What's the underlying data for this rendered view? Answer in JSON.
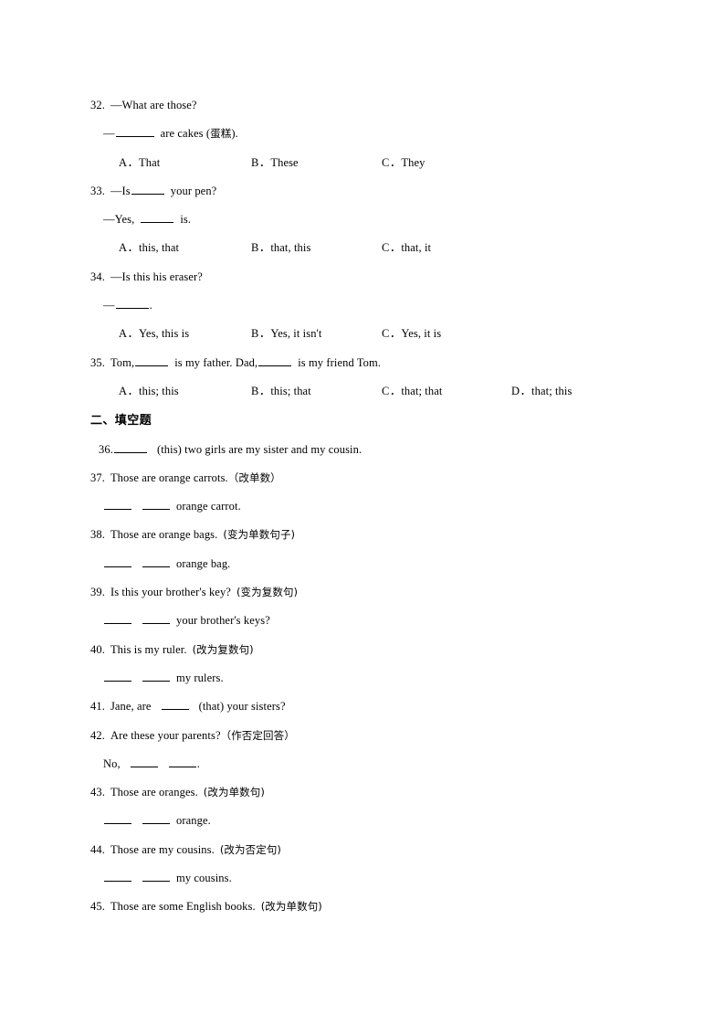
{
  "document": {
    "type": "worksheet",
    "language": "en-zh",
    "page_background": "#ffffff",
    "text_color": "#000000"
  },
  "multiple_choice": {
    "questions": [
      {
        "number": "32.",
        "stem_dash": "—",
        "stem": "What are those?",
        "answer_prefix": "—",
        "answer_suffix": "are cakes (",
        "answer_cjk": "蛋糕",
        "answer_end": ").",
        "options": [
          {
            "letter": "A",
            "sep": "．",
            "text": "That"
          },
          {
            "letter": "B",
            "sep": "．",
            "text": "These"
          },
          {
            "letter": "C",
            "sep": "．",
            "text": "They"
          }
        ]
      },
      {
        "number": "33.",
        "stem_dash": "—",
        "stem_before": "Is",
        "stem_after": "your pen?",
        "answer_prefix": "—Yes,",
        "answer_suffix": "is.",
        "options": [
          {
            "letter": "A",
            "sep": "．",
            "text": "this, that"
          },
          {
            "letter": "B",
            "sep": "．",
            "text": "that, this"
          },
          {
            "letter": "C",
            "sep": "．",
            "text": "that, it"
          }
        ]
      },
      {
        "number": "34.",
        "stem_dash": "—",
        "stem": "Is this his eraser?",
        "answer_prefix": "—",
        "answer_end": ".",
        "options": [
          {
            "letter": "A",
            "sep": "．",
            "text": "Yes, this is"
          },
          {
            "letter": "B",
            "sep": "．",
            "text": "Yes, it isn't"
          },
          {
            "letter": "C",
            "sep": "．",
            "text": "Yes, it is"
          }
        ]
      },
      {
        "number": "35.",
        "stem_part1": "Tom,",
        "stem_part2": "is my father. Dad,",
        "stem_part3": "is my friend Tom.",
        "options": [
          {
            "letter": "A",
            "sep": "．",
            "text": "this; this"
          },
          {
            "letter": "B",
            "sep": "．",
            "text": "this; that"
          },
          {
            "letter": "C",
            "sep": "．",
            "text": "that; that"
          },
          {
            "letter": "D",
            "sep": "．",
            "text": "that; this"
          }
        ]
      }
    ]
  },
  "section_two": {
    "heading_number": "二、",
    "heading_title": "填空题",
    "heading_full": "二、填空题",
    "questions": [
      {
        "number": "36.",
        "after_blank": "(this) two girls are my sister and my cousin."
      },
      {
        "number": "37.",
        "prompt": "Those are orange carrots.",
        "instruction": "（改单数）",
        "answer_tail": "orange carrot."
      },
      {
        "number": "38.",
        "prompt": "Those are orange bags.",
        "instruction": "(变为单数句子)",
        "answer_tail": "orange bag."
      },
      {
        "number": "39.",
        "prompt": "Is this your brother's key?",
        "instruction": "(变为复数句)",
        "answer_tail": "your brother's keys?"
      },
      {
        "number": "40.",
        "prompt": "This is my ruler.",
        "instruction": "(改为复数句)",
        "answer_tail": "my rulers."
      },
      {
        "number": "41.",
        "prompt_before": "Jane, are",
        "prompt_after": "(that) your sisters?"
      },
      {
        "number": "42.",
        "prompt": "Are these your parents?",
        "instruction": "（作否定回答）",
        "answer_prefix": "No,",
        "answer_end": "."
      },
      {
        "number": "43.",
        "prompt": "Those are oranges.",
        "instruction": "(改为单数句)",
        "answer_tail": "orange."
      },
      {
        "number": "44.",
        "prompt": "Those are my cousins.",
        "instruction": "(改为否定句)",
        "answer_tail": "my cousins."
      },
      {
        "number": "45.",
        "prompt": "Those are some English books.",
        "instruction": "(改为单数句)"
      }
    ]
  }
}
